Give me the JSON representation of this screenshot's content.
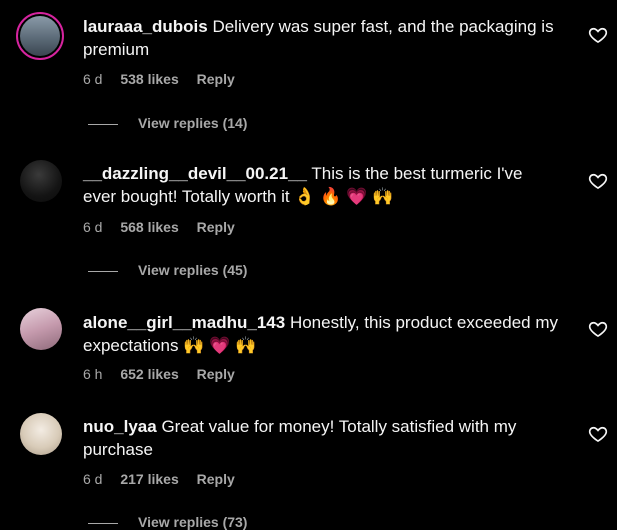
{
  "comments": [
    {
      "username": "lauraaa_dubois",
      "text": "Delivery was super fast, and the packaging is premium",
      "time": "6 d",
      "likes": "538 likes",
      "reply": "Reply",
      "view_replies": "View replies (14)",
      "avatar_color": "#6b7a86"
    },
    {
      "username": "__dazzling__devil__00.21__",
      "text": "This is the best turmeric I've ever bought! Totally worth it 👌  🔥 💗 🙌",
      "time": "6 d",
      "likes": "568 likes",
      "reply": "Reply",
      "view_replies": "View replies (45)",
      "avatar_color": "#1a1a1a"
    },
    {
      "username": "alone__girl__madhu_143",
      "text": "Honestly, this product exceeded my expectations 🙌 💗 🙌",
      "time": "6 h",
      "likes": "652 likes",
      "reply": "Reply",
      "view_replies": "",
      "avatar_color": "#c9a9b6"
    },
    {
      "username": "nuo_lyaa",
      "text": "Great value for money! Totally satisfied with my purchase",
      "time": "6 d",
      "likes": "217 likes",
      "reply": "Reply",
      "view_replies": "View replies (73)",
      "avatar_color": "#d9cfc2"
    }
  ]
}
